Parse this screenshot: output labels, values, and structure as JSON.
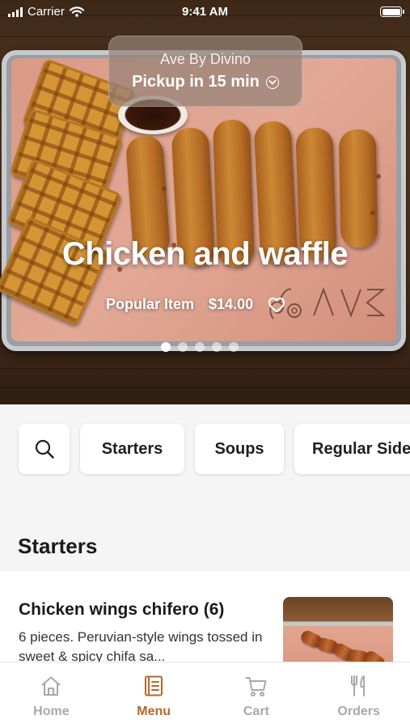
{
  "status_bar": {
    "carrier": "Carrier",
    "time": "9:41 AM"
  },
  "pickup": {
    "restaurant": "Ave By Divino",
    "label": "Pickup in 15 min"
  },
  "hero": {
    "title": "Chicken and waffle",
    "tag": "Popular Item",
    "price": "$14.00",
    "carousel": {
      "total": 5,
      "active_index": 0
    }
  },
  "categories": [
    {
      "label": "Starters"
    },
    {
      "label": "Soups"
    },
    {
      "label": "Regular Sides"
    }
  ],
  "section": {
    "heading": "Starters"
  },
  "menu_item": {
    "name": "Chicken wings chifero  (6)",
    "description": "6 pieces. Peruvian-style wings tossed in sweet & spicy chifa sa..."
  },
  "tab_bar": {
    "tabs": [
      {
        "label": "Home",
        "icon": "home-icon"
      },
      {
        "label": "Menu",
        "icon": "menu-book-icon",
        "active": true
      },
      {
        "label": "Cart",
        "icon": "cart-icon"
      },
      {
        "label": "Orders",
        "icon": "fork-knife-icon"
      }
    ]
  },
  "colors": {
    "accent": "#b9652a",
    "inactive": "#a8a8a8"
  }
}
